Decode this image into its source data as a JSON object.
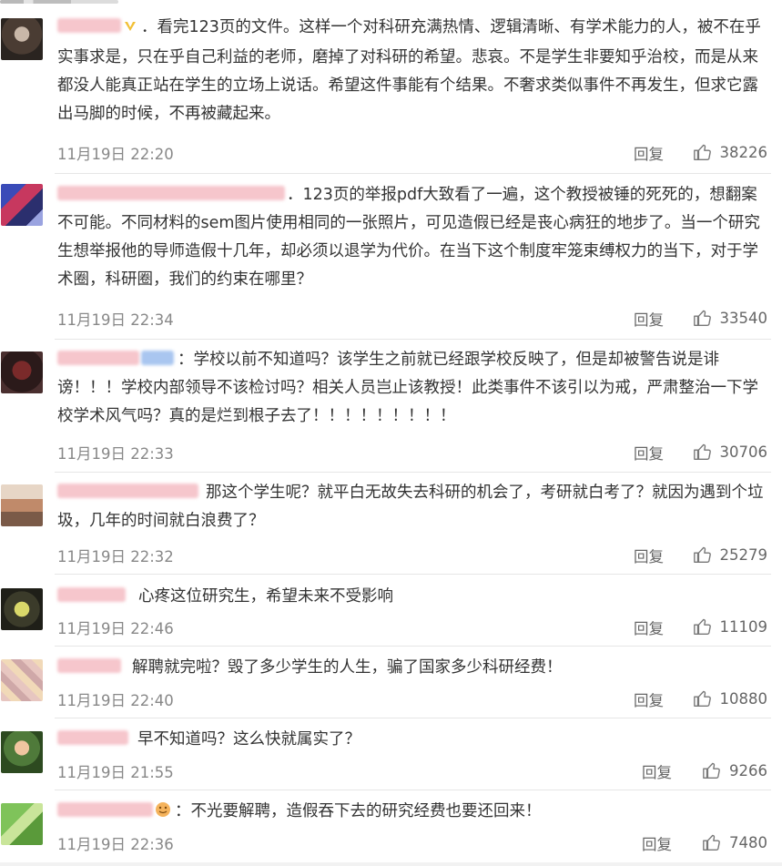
{
  "comments": [
    {
      "text": "．看完123页的文件。这样一个对科研充满热情、逻辑清晰、有学术能力的人，被不在乎实事求是，只在乎自己利益的老师，磨掉了对科研的希望。悲哀。不是学生非要知乎治校，而是从来都没人能真正站在学生的立场上说话。希望这件事能有个结果。不奢求类似事件不再发生，但求它露出马脚的时候，不再被藏起来。",
      "time": "11月19日 22:20",
      "reply": "回复",
      "likes": "38226"
    },
    {
      "text": "．123页的举报pdf大致看了一遍，这个教授被锤的死死的，想翻案不可能。不同材料的sem图片使用相同的一张照片，可见造假已经是丧心病狂的地步了。当一个研究生想举报他的导师造假十几年，却必须以退学为代价。在当下这个制度牢笼束缚权力的当下，对于学术圈，科研圈，我们的约束在哪里？",
      "time": "11月19日 22:34",
      "reply": "回复",
      "likes": "33540"
    },
    {
      "text": "：学校以前不知道吗？该学生之前就已经跟学校反映了，但是却被警告说是诽谤！！！学校内部领导不该检讨吗？相关人员岂止该教授！此类事件不该引以为戒，严肃整治一下学校学术风气吗？真的是烂到根子去了！！！！！！！！！",
      "time": "11月19日 22:33",
      "reply": "回复",
      "likes": "30706"
    },
    {
      "text": "那这个学生呢？就平白无故失去科研的机会了，考研就白考了？就因为遇到个垃圾，几年的时间就白浪费了？",
      "time": "11月19日 22:32",
      "reply": "回复",
      "likes": "25279"
    },
    {
      "text": "心疼这位研究生，希望未来不受影响",
      "time": "11月19日 22:46",
      "reply": "回复",
      "likes": "11109"
    },
    {
      "text": "解聘就完啦？毁了多少学生的人生，骗了国家多少科研经费！",
      "time": "11月19日 22:40",
      "reply": "回复",
      "likes": "10880"
    },
    {
      "text": "早不知道吗？这么快就属实了？",
      "time": "11月19日 21:55",
      "reply": "回复",
      "likes": "9266"
    },
    {
      "text": "：不光要解聘，造假吞下去的研究经费也要还回来！",
      "time": "11月19日 22:36",
      "reply": "回复",
      "likes": "7480"
    }
  ],
  "colors": {
    "text": "#333333",
    "meta": "#888888",
    "divider": "#e6e6e6"
  }
}
